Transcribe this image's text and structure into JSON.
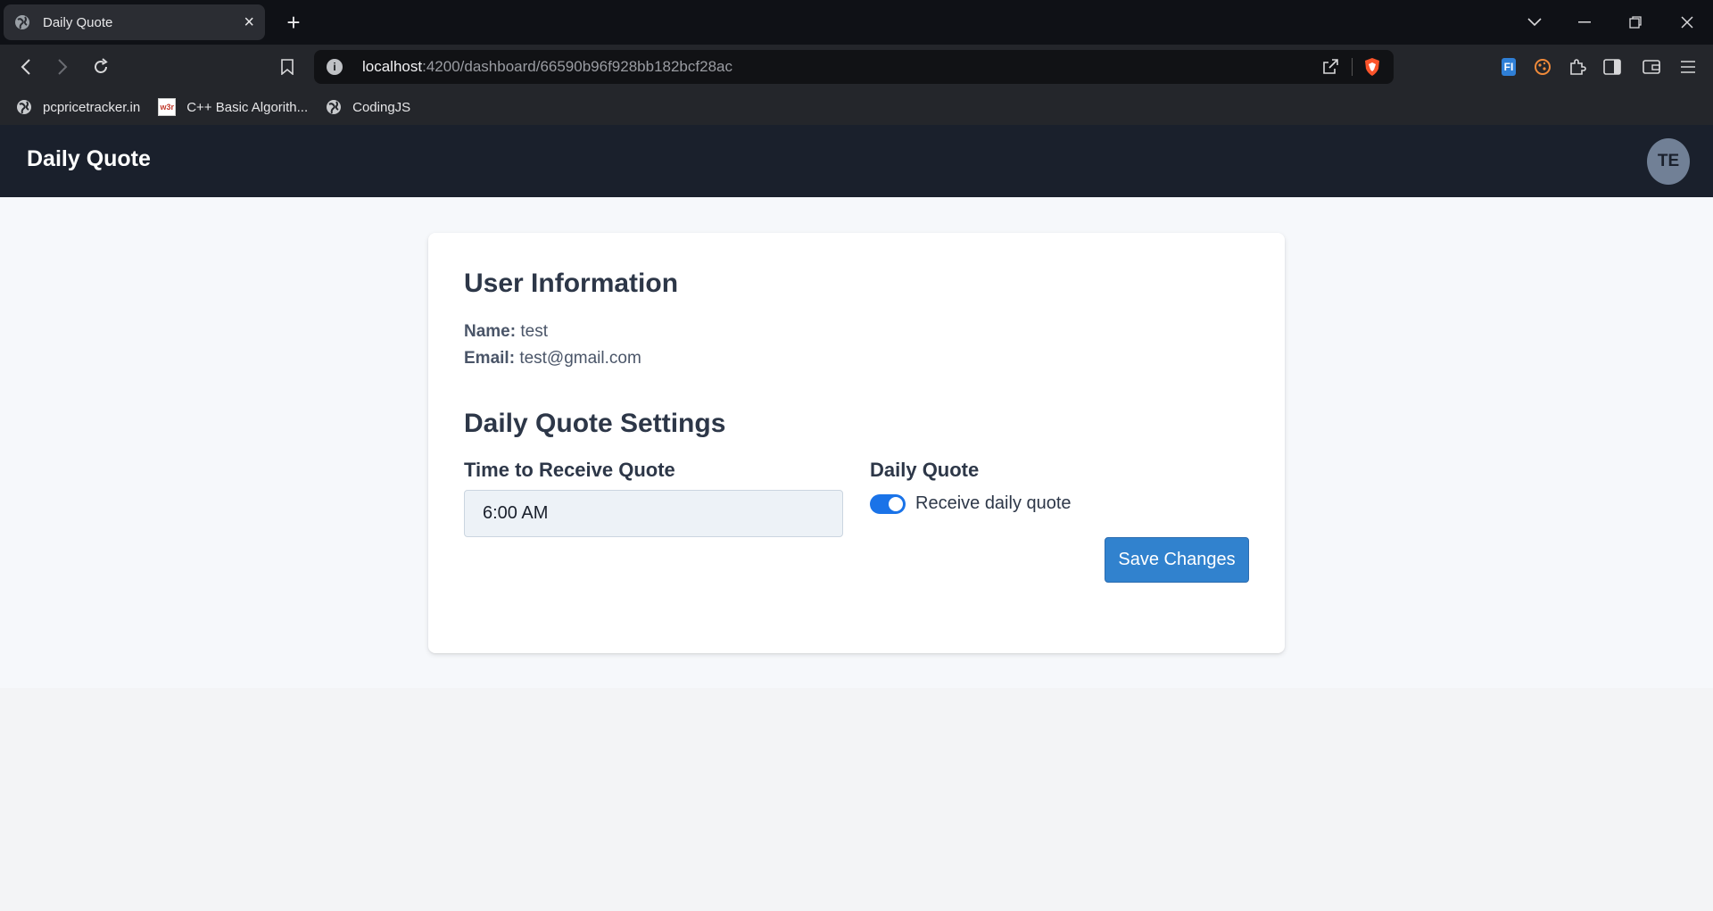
{
  "browser": {
    "tab_title": "Daily Quote",
    "new_tab_label": "+",
    "url_host": "localhost",
    "url_path": ":4200/dashboard/66590b96f928bb182bcf28ac",
    "bookmarks": [
      {
        "label": "pcpricetracker.in",
        "icon": "globe-icon"
      },
      {
        "label": "C++ Basic Algorith...",
        "icon": "w3-icon"
      },
      {
        "label": "CodingJS",
        "icon": "globe-icon"
      }
    ],
    "extension_badge": "FI"
  },
  "app": {
    "title": "Daily Quote",
    "avatar_initials": "TE"
  },
  "user_info": {
    "heading": "User Information",
    "name_label": "Name:",
    "name_value": "test",
    "email_label": "Email:",
    "email_value": "test@gmail.com"
  },
  "settings": {
    "heading": "Daily Quote Settings",
    "time_label": "Time to Receive Quote",
    "time_value": "6:00 AM",
    "daily_label": "Daily Quote",
    "toggle_label": "Receive daily quote",
    "toggle_on": true,
    "save_label": "Save Changes"
  },
  "colors": {
    "appbar": "#1a202c",
    "accent": "#3182ce",
    "toggle": "#1a73e8"
  }
}
